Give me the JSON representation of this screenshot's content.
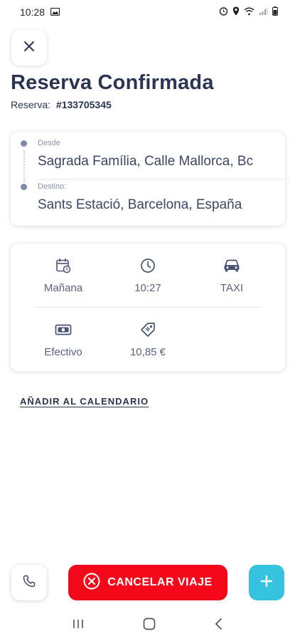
{
  "status_bar": {
    "time": "10:28",
    "icons": [
      "image-icon",
      "alarm-icon",
      "location-icon",
      "wifi-icon",
      "signal-icon",
      "battery-icon"
    ]
  },
  "header": {
    "title": "Reserva Confirmada",
    "reserva_label": "Reserva:",
    "reserva_number": "#133705345"
  },
  "route": {
    "from_label": "Desde",
    "from_value": "Sagrada Família, Calle Mallorca, Bc",
    "to_label": "Destino:",
    "to_value": "Sants Estació, Barcelona, España"
  },
  "details": {
    "date": "Mañana",
    "time": "10:27",
    "vehicle": "TAXI",
    "payment": "Efectivo",
    "price": "10,85 €"
  },
  "links": {
    "add_calendar": "AÑADIR AL CALENDARIO"
  },
  "actions": {
    "cancel_label": "CANCELAR VIAJE",
    "add_label": "+"
  },
  "colors": {
    "title": "#2b3553",
    "cancel": "#f4081a",
    "add": "#36c3df",
    "text_muted": "#5a6278"
  }
}
